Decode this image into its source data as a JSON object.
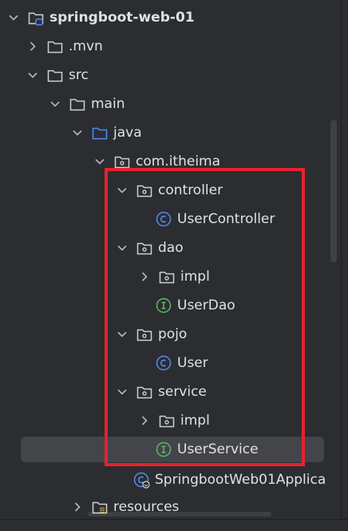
{
  "colors": {
    "background": "#2b2d30",
    "text": "#dfe1e5",
    "folder_icon": "#ced0d6",
    "source_folder_icon": "#548af7",
    "class_icon": "#548af7",
    "interface_icon": "#5fb865",
    "selection": "#43454a",
    "annotation_box": "#e8212e"
  },
  "tree": {
    "project": {
      "label": "springboot-web-01",
      "icon": "project-folder-icon"
    },
    "mvn": {
      "label": ".mvn",
      "icon": "folder-icon"
    },
    "src": {
      "label": "src",
      "icon": "folder-icon"
    },
    "main": {
      "label": "main",
      "icon": "folder-icon"
    },
    "java": {
      "label": "java",
      "icon": "source-folder-icon"
    },
    "package_root": {
      "label": "com.itheima",
      "icon": "package-icon"
    },
    "controller": {
      "label": "controller",
      "icon": "package-icon"
    },
    "user_controller": {
      "label": "UserController",
      "icon": "class-icon"
    },
    "dao": {
      "label": "dao",
      "icon": "package-icon"
    },
    "dao_impl": {
      "label": "impl",
      "icon": "package-icon"
    },
    "user_dao": {
      "label": "UserDao",
      "icon": "interface-icon"
    },
    "pojo": {
      "label": "pojo",
      "icon": "package-icon"
    },
    "user": {
      "label": "User",
      "icon": "class-icon"
    },
    "service": {
      "label": "service",
      "icon": "package-icon"
    },
    "service_impl": {
      "label": "impl",
      "icon": "package-icon"
    },
    "user_service": {
      "label": "UserService",
      "icon": "interface-icon"
    },
    "application": {
      "label": "SpringbootWeb01Applica",
      "icon": "spring-boot-class-icon"
    },
    "resources": {
      "label": "resources",
      "icon": "resources-folder-icon"
    }
  }
}
